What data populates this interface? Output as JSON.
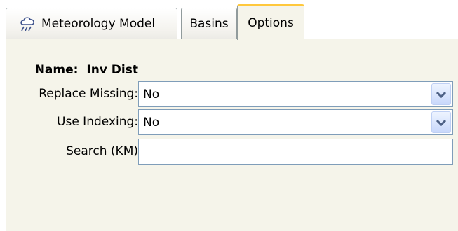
{
  "tabs": {
    "meteorology_model": "Meteorology Model",
    "basins": "Basins",
    "options": "Options",
    "active": "options"
  },
  "form": {
    "name_label": "Name:",
    "name_value": "Inv Dist",
    "replace_missing_label": "Replace Missing:",
    "replace_missing_value": "No",
    "use_indexing_label": "Use Indexing:",
    "use_indexing_value": "No",
    "search_label": "Search (KM)",
    "search_value": ""
  },
  "colors": {
    "panel_bg": "#f5f4ea",
    "active_tab_accent": "#ffc83c",
    "field_border": "#7f9db9",
    "dropdown_arrow": "#4d6185"
  },
  "icons": {
    "meteorology_tab": "weather-cloud-rain-icon",
    "dropdown": "chevron-down-icon"
  }
}
